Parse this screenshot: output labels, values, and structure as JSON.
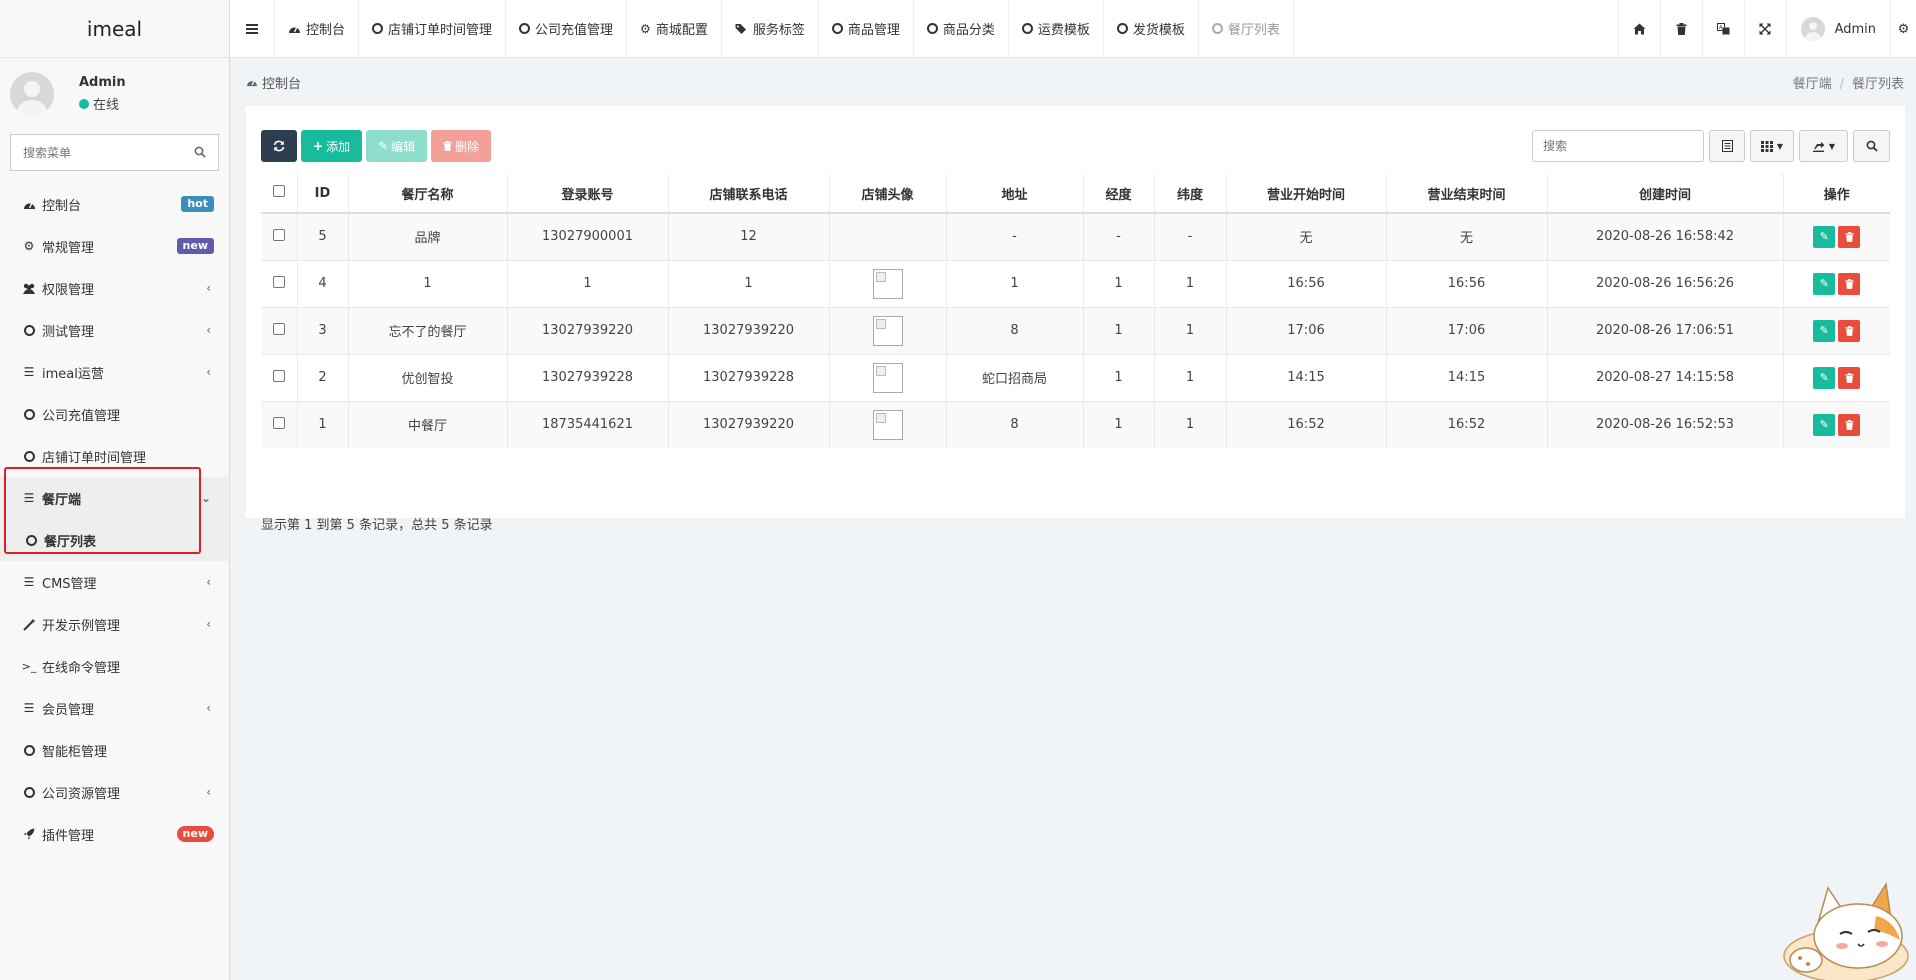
{
  "app": {
    "logo": "imeal"
  },
  "user": {
    "name": "Admin",
    "status": "在线"
  },
  "sidebar": {
    "search_placeholder": "搜索菜单",
    "items": [
      {
        "label": "控制台",
        "badge": "hot"
      },
      {
        "label": "常规管理",
        "badge": "new"
      },
      {
        "label": "权限管理"
      },
      {
        "label": "测试管理"
      },
      {
        "label": "imeal运营"
      },
      {
        "label": "公司充值管理"
      },
      {
        "label": "店铺订单时间管理"
      },
      {
        "label": "餐厅端"
      },
      {
        "label": "餐厅列表"
      },
      {
        "label": "CMS管理"
      },
      {
        "label": "开发示例管理"
      },
      {
        "label": "在线命令管理"
      },
      {
        "label": "会员管理"
      },
      {
        "label": "智能柜管理"
      },
      {
        "label": "公司资源管理"
      },
      {
        "label": "插件管理",
        "badge": "new"
      }
    ]
  },
  "topnav": {
    "tabs": [
      "控制台",
      "店铺订单时间管理",
      "公司充值管理",
      "商城配置",
      "服务标签",
      "商品管理",
      "商品分类",
      "运费模板",
      "发货模板",
      "餐厅列表"
    ],
    "user_name": "Admin"
  },
  "content": {
    "page_title": "控制台",
    "breadcrumb": [
      "餐厅端",
      "餐厅列表"
    ]
  },
  "toolbar": {
    "add": "添加",
    "edit": "编辑",
    "delete": "删除",
    "search_placeholder": "搜索"
  },
  "table": {
    "columns": [
      "ID",
      "餐厅名称",
      "登录账号",
      "店铺联系电话",
      "店铺头像",
      "地址",
      "经度",
      "纬度",
      "营业开始时间",
      "营业结束时间",
      "创建时间",
      "操作"
    ],
    "rows": [
      {
        "id": "5",
        "name": "品牌",
        "account": "13027900001",
        "phone": "12",
        "avatar": false,
        "address": "-",
        "lng": "-",
        "lat": "-",
        "start": "无",
        "end": "无",
        "created": "2020-08-26 16:58:42"
      },
      {
        "id": "4",
        "name": "1",
        "account": "1",
        "phone": "1",
        "avatar": true,
        "address": "1",
        "lng": "1",
        "lat": "1",
        "start": "16:56",
        "end": "16:56",
        "created": "2020-08-26 16:56:26"
      },
      {
        "id": "3",
        "name": "忘不了的餐厅",
        "account": "13027939220",
        "phone": "13027939220",
        "avatar": true,
        "address": "8",
        "lng": "1",
        "lat": "1",
        "start": "17:06",
        "end": "17:06",
        "created": "2020-08-26 17:06:51"
      },
      {
        "id": "2",
        "name": "优创智投",
        "account": "13027939228",
        "phone": "13027939228",
        "avatar": true,
        "address": "蛇口招商局",
        "lng": "1",
        "lat": "1",
        "start": "14:15",
        "end": "14:15",
        "created": "2020-08-27 14:15:58"
      },
      {
        "id": "1",
        "name": "中餐厅",
        "account": "18735441621",
        "phone": "13027939220",
        "avatar": true,
        "address": "8",
        "lng": "1",
        "lat": "1",
        "start": "16:52",
        "end": "16:52",
        "created": "2020-08-26 16:52:53"
      }
    ]
  },
  "pagination": {
    "summary": "显示第 1 到第 5 条记录，总共 5 条记录"
  },
  "colors": {
    "primary": "#18bc9c",
    "dark": "#2c3e50",
    "danger": "#e74c3c",
    "hot": "#3c8dbc",
    "new": "#605ca8",
    "highlight": "#e02020"
  }
}
